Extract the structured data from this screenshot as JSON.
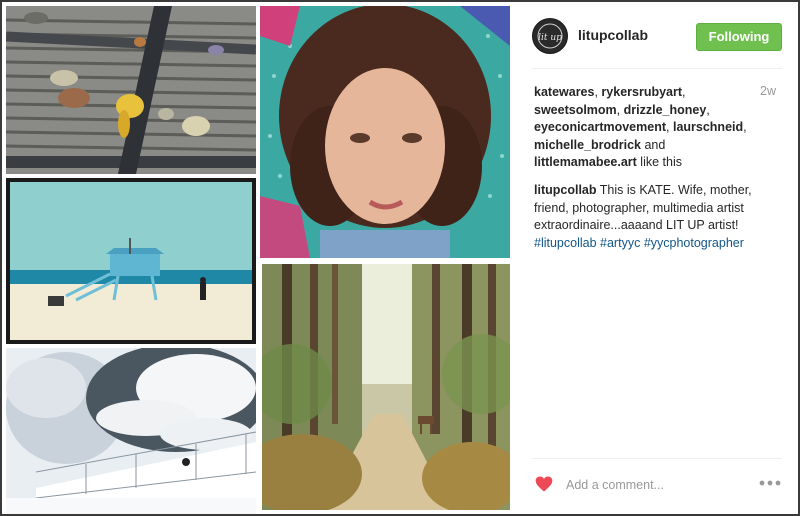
{
  "post": {
    "username": "litupcollab",
    "follow_label": "Following",
    "age": "2w",
    "likes": {
      "users": [
        "katewares",
        "rykersrubyart",
        "sweetsolmom",
        "drizzle_honey",
        "eyeconicartmovement",
        "laurschneid",
        "michelle_brodrick",
        "littlemamabee.art"
      ],
      "separator": ", ",
      "and_word": "and",
      "suffix": "like this"
    },
    "caption": {
      "author": "litupcollab",
      "text": "This is KATE. Wife, mother, friend, photographer, multimedia artist extraordinaire...aaaand LIT UP artist!",
      "hashtags": [
        "#litupcollab",
        "#artyyc",
        "#yycphotographer"
      ]
    },
    "comment": {
      "placeholder": "Add a comment..."
    },
    "avatar_text": "lit up"
  },
  "colors": {
    "follow_button": "#70c050",
    "heart": "#ed4956",
    "hashtag": "#125688"
  },
  "icons": {
    "heart": "heart-icon",
    "more": "more-options-icon"
  }
}
